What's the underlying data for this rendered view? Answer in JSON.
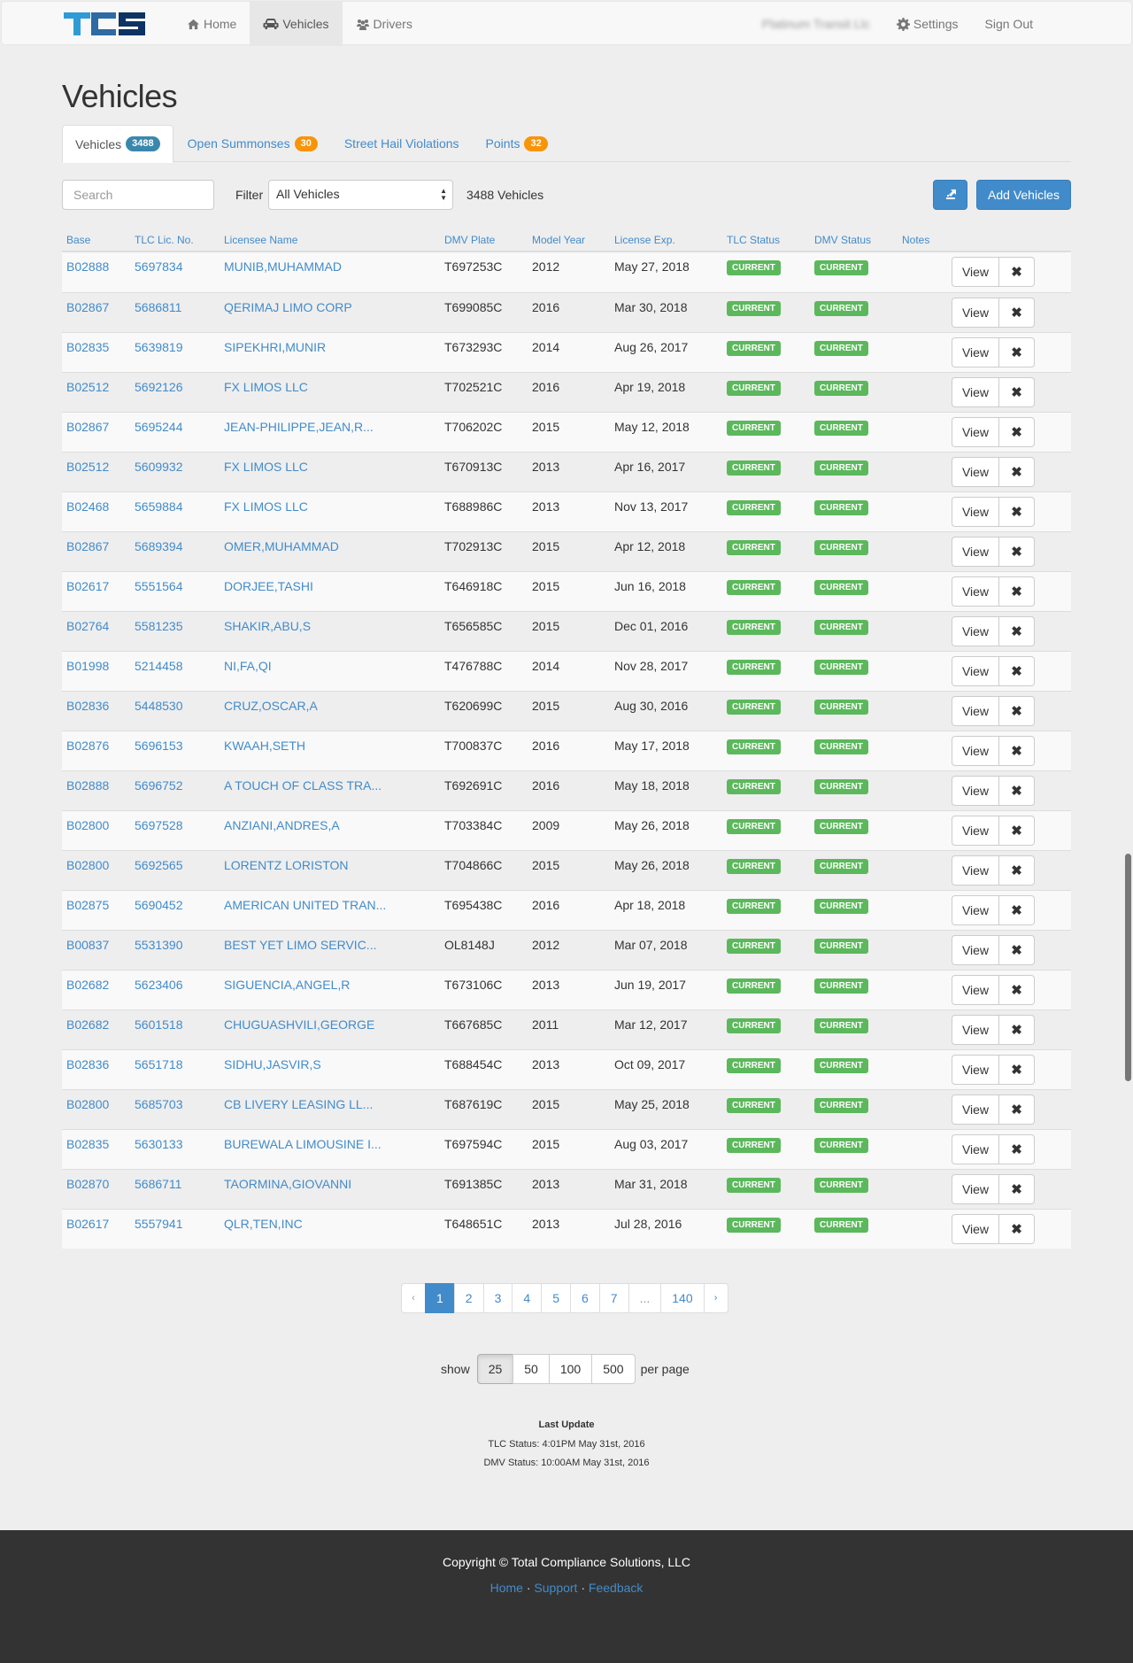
{
  "navbar": {
    "brand": "TCS",
    "brand_colors": [
      "#2f9bd6",
      "#2e6aa3",
      "#0d3264"
    ],
    "items": [
      {
        "label": "Home",
        "icon": "home-icon",
        "active": false
      },
      {
        "label": "Vehicles",
        "icon": "car-icon",
        "active": true
      },
      {
        "label": "Drivers",
        "icon": "users-icon",
        "active": false
      }
    ],
    "account_name": "Platinum Transit Llc",
    "settings_label": "Settings",
    "signout_label": "Sign Out"
  },
  "page": {
    "title": "Vehicles"
  },
  "tabs": [
    {
      "label": "Vehicles",
      "badge": "3488",
      "badge_color": "#3a87ad",
      "active": true
    },
    {
      "label": "Open Summonses",
      "badge": "30",
      "badge_color": "#f89406",
      "active": false
    },
    {
      "label": "Street Hail Violations",
      "badge": null,
      "active": false
    },
    {
      "label": "Points",
      "badge": "32",
      "badge_color": "#f89406",
      "active": false
    }
  ],
  "toolbar": {
    "search_placeholder": "Search",
    "filter_label": "Filter",
    "filter_value": "All Vehicles",
    "count_text": "3488 Vehicles",
    "export_icon": "export-icon",
    "add_label": "Add Vehicles"
  },
  "table": {
    "headers": [
      "Base",
      "TLC Lic. No.",
      "Licensee Name",
      "DMV Plate",
      "Model Year",
      "License Exp.",
      "TLC Status",
      "DMV Status",
      "Notes"
    ],
    "view_label": "View",
    "delete_glyph": "✖",
    "rows": [
      {
        "base": "B02888",
        "tlc": "5697834",
        "name": "MUNIB,MUHAMMAD",
        "plate": "T697253C",
        "year": "2012",
        "exp": "May 27, 2018",
        "tlc_status": "CURRENT",
        "dmv_status": "CURRENT"
      },
      {
        "base": "B02867",
        "tlc": "5686811",
        "name": "QERIMAJ LIMO CORP",
        "plate": "T699085C",
        "year": "2016",
        "exp": "Mar 30, 2018",
        "tlc_status": "CURRENT",
        "dmv_status": "CURRENT"
      },
      {
        "base": "B02835",
        "tlc": "5639819",
        "name": "SIPEKHRI,MUNIR",
        "plate": "T673293C",
        "year": "2014",
        "exp": "Aug 26, 2017",
        "tlc_status": "CURRENT",
        "dmv_status": "CURRENT"
      },
      {
        "base": "B02512",
        "tlc": "5692126",
        "name": "FX LIMOS LLC",
        "plate": "T702521C",
        "year": "2016",
        "exp": "Apr 19, 2018",
        "tlc_status": "CURRENT",
        "dmv_status": "CURRENT"
      },
      {
        "base": "B02867",
        "tlc": "5695244",
        "name": "JEAN-PHILIPPE,JEAN,R...",
        "plate": "T706202C",
        "year": "2015",
        "exp": "May 12, 2018",
        "tlc_status": "CURRENT",
        "dmv_status": "CURRENT"
      },
      {
        "base": "B02512",
        "tlc": "5609932",
        "name": "FX LIMOS LLC",
        "plate": "T670913C",
        "year": "2013",
        "exp": "Apr 16, 2017",
        "tlc_status": "CURRENT",
        "dmv_status": "CURRENT"
      },
      {
        "base": "B02468",
        "tlc": "5659884",
        "name": "FX LIMOS LLC",
        "plate": "T688986C",
        "year": "2013",
        "exp": "Nov 13, 2017",
        "tlc_status": "CURRENT",
        "dmv_status": "CURRENT"
      },
      {
        "base": "B02867",
        "tlc": "5689394",
        "name": "OMER,MUHAMMAD",
        "plate": "T702913C",
        "year": "2015",
        "exp": "Apr 12, 2018",
        "tlc_status": "CURRENT",
        "dmv_status": "CURRENT"
      },
      {
        "base": "B02617",
        "tlc": "5551564",
        "name": "DORJEE,TASHI",
        "plate": "T646918C",
        "year": "2015",
        "exp": "Jun 16, 2018",
        "tlc_status": "CURRENT",
        "dmv_status": "CURRENT"
      },
      {
        "base": "B02764",
        "tlc": "5581235",
        "name": "SHAKIR,ABU,S",
        "plate": "T656585C",
        "year": "2015",
        "exp": "Dec 01, 2016",
        "tlc_status": "CURRENT",
        "dmv_status": "CURRENT"
      },
      {
        "base": "B01998",
        "tlc": "5214458",
        "name": "NI,FA,QI",
        "plate": "T476788C",
        "year": "2014",
        "exp": "Nov 28, 2017",
        "tlc_status": "CURRENT",
        "dmv_status": "CURRENT"
      },
      {
        "base": "B02836",
        "tlc": "5448530",
        "name": "CRUZ,OSCAR,A",
        "plate": "T620699C",
        "year": "2015",
        "exp": "Aug 30, 2016",
        "tlc_status": "CURRENT",
        "dmv_status": "CURRENT"
      },
      {
        "base": "B02876",
        "tlc": "5696153",
        "name": "KWAAH,SETH",
        "plate": "T700837C",
        "year": "2016",
        "exp": "May 17, 2018",
        "tlc_status": "CURRENT",
        "dmv_status": "CURRENT"
      },
      {
        "base": "B02888",
        "tlc": "5696752",
        "name": "A TOUCH OF CLASS TRA...",
        "plate": "T692691C",
        "year": "2016",
        "exp": "May 18, 2018",
        "tlc_status": "CURRENT",
        "dmv_status": "CURRENT"
      },
      {
        "base": "B02800",
        "tlc": "5697528",
        "name": "ANZIANI,ANDRES,A",
        "plate": "T703384C",
        "year": "2009",
        "exp": "May 26, 2018",
        "tlc_status": "CURRENT",
        "dmv_status": "CURRENT"
      },
      {
        "base": "B02800",
        "tlc": "5692565",
        "name": "LORENTZ LORISTON",
        "plate": "T704866C",
        "year": "2015",
        "exp": "May 26, 2018",
        "tlc_status": "CURRENT",
        "dmv_status": "CURRENT"
      },
      {
        "base": "B02875",
        "tlc": "5690452",
        "name": "AMERICAN UNITED TRAN...",
        "plate": "T695438C",
        "year": "2016",
        "exp": "Apr 18, 2018",
        "tlc_status": "CURRENT",
        "dmv_status": "CURRENT"
      },
      {
        "base": "B00837",
        "tlc": "5531390",
        "name": "BEST YET LIMO SERVIC...",
        "plate": "OL8148J",
        "year": "2012",
        "exp": "Mar 07, 2018",
        "tlc_status": "CURRENT",
        "dmv_status": "CURRENT"
      },
      {
        "base": "B02682",
        "tlc": "5623406",
        "name": "SIGUENCIA,ANGEL,R",
        "plate": "T673106C",
        "year": "2013",
        "exp": "Jun 19, 2017",
        "tlc_status": "CURRENT",
        "dmv_status": "CURRENT"
      },
      {
        "base": "B02682",
        "tlc": "5601518",
        "name": "CHUGUASHVILI,GEORGE",
        "plate": "T667685C",
        "year": "2011",
        "exp": "Mar 12, 2017",
        "tlc_status": "CURRENT",
        "dmv_status": "CURRENT"
      },
      {
        "base": "B02836",
        "tlc": "5651718",
        "name": "SIDHU,JASVIR,S",
        "plate": "T688454C",
        "year": "2013",
        "exp": "Oct 09, 2017",
        "tlc_status": "CURRENT",
        "dmv_status": "CURRENT"
      },
      {
        "base": "B02800",
        "tlc": "5685703",
        "name": "CB LIVERY LEASING LL...",
        "plate": "T687619C",
        "year": "2015",
        "exp": "May 25, 2018",
        "tlc_status": "CURRENT",
        "dmv_status": "CURRENT"
      },
      {
        "base": "B02835",
        "tlc": "5630133",
        "name": "BUREWALA LIMOUSINE I...",
        "plate": "T697594C",
        "year": "2015",
        "exp": "Aug 03, 2017",
        "tlc_status": "CURRENT",
        "dmv_status": "CURRENT"
      },
      {
        "base": "B02870",
        "tlc": "5686711",
        "name": "TAORMINA,GIOVANNI",
        "plate": "T691385C",
        "year": "2013",
        "exp": "Mar 31, 2018",
        "tlc_status": "CURRENT",
        "dmv_status": "CURRENT"
      },
      {
        "base": "B02617",
        "tlc": "5557941",
        "name": "QLR,TEN,INC",
        "plate": "T648651C",
        "year": "2013",
        "exp": "Jul 28, 2016",
        "tlc_status": "CURRENT",
        "dmv_status": "CURRENT"
      }
    ]
  },
  "pagination": {
    "prev": "‹",
    "next": "›",
    "pages": [
      "1",
      "2",
      "3",
      "4",
      "5",
      "6",
      "7",
      "...",
      "140"
    ],
    "current": "1"
  },
  "per_page": {
    "label_before": "show",
    "options": [
      "25",
      "50",
      "100",
      "500"
    ],
    "selected": "25",
    "label_after": "per page"
  },
  "last_update": {
    "title": "Last Update",
    "tlc": "TLC Status: 4:01PM May 31st, 2016",
    "dmv": "DMV Status: 10:00AM May 31st, 2016"
  },
  "footer": {
    "copyright": "Copyright © Total Compliance Solutions, LLC",
    "links": [
      "Home",
      "Support",
      "Feedback"
    ],
    "separator": "·"
  },
  "colors": {
    "primary": "#428bca",
    "success": "#5cb85c",
    "badge_blue": "#3a87ad",
    "badge_orange": "#f89406",
    "footer_bg": "#333333"
  }
}
